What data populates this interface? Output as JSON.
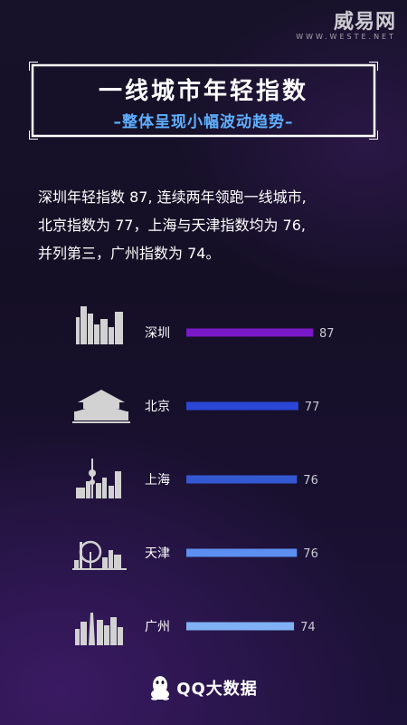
{
  "watermark": {
    "logo": "威易网",
    "url": "WWW.WESTE.NET"
  },
  "header": {
    "title": "一线城市年轻指数",
    "subtitle": "–整体呈现小幅波动趋势–"
  },
  "summary": {
    "line1": "深圳年轻指数 87, 连续两年领跑一线城市,",
    "line2": "北京指数为 77，上海与天津指数均为 76,",
    "line3": "并列第三，广州指数为 74。"
  },
  "chart_data": {
    "type": "bar",
    "orientation": "horizontal",
    "categories": [
      "深圳",
      "北京",
      "上海",
      "天津",
      "广州"
    ],
    "values": [
      87,
      77,
      76,
      76,
      74
    ],
    "colors": [
      "#7b18c9",
      "#2a47d8",
      "#3358d2",
      "#5c8ff0",
      "#7fb1f4"
    ],
    "category_icons": [
      "shenzhen-skyline-icon",
      "tiananmen-icon",
      "shanghai-skyline-icon",
      "tianjin-skyline-icon",
      "guangzhou-skyline-icon"
    ],
    "title": "",
    "xlabel": "",
    "ylabel": "",
    "grid": false,
    "legend": "none"
  },
  "footer": {
    "brand": "QQ大数据",
    "icon": "qq-penguin-icon"
  }
}
